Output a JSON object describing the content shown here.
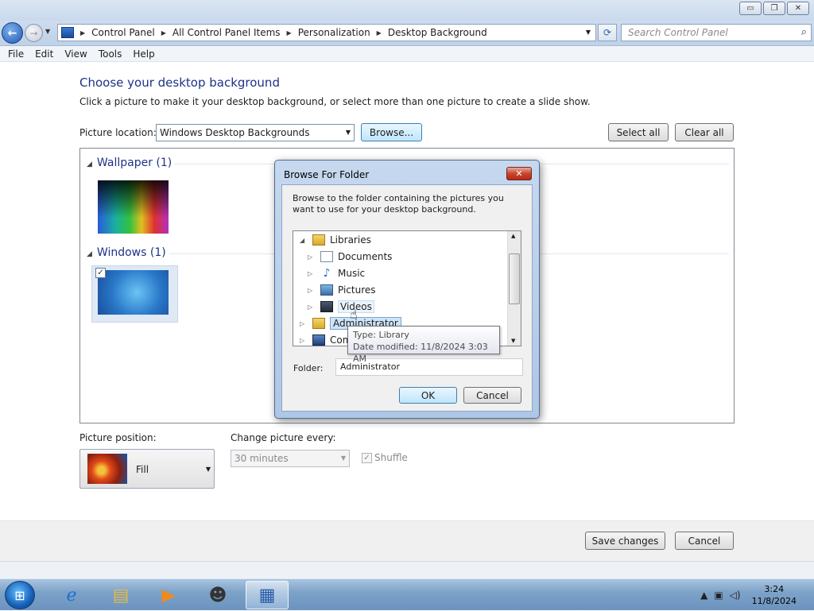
{
  "window": {
    "buttons": {
      "minimize": "▭",
      "maximize": "❐",
      "close": "✕"
    }
  },
  "nav": {
    "breadcrumbs": [
      "Control Panel",
      "All Control Panel Items",
      "Personalization",
      "Desktop Background"
    ],
    "search_placeholder": "Search Control Panel"
  },
  "menu": [
    "File",
    "Edit",
    "View",
    "Tools",
    "Help"
  ],
  "page": {
    "title": "Choose your desktop background",
    "description": "Click a picture to make it your desktop background, or select more than one picture to create a slide show.",
    "location_label": "Picture location:",
    "location_value": "Windows Desktop Backgrounds",
    "browse_label": "Browse...",
    "select_all_label": "Select all",
    "clear_all_label": "Clear all",
    "groups": [
      {
        "name": "Wallpaper (1)"
      },
      {
        "name": "Windows (1)"
      }
    ],
    "position_label": "Picture position:",
    "position_value": "Fill",
    "change_label": "Change picture every:",
    "change_value": "30 minutes",
    "shuffle_label": "Shuffle",
    "save_label": "Save changes",
    "cancel_label": "Cancel"
  },
  "dialog": {
    "title": "Browse For Folder",
    "description": "Browse to the folder containing the pictures you want to use for your desktop background.",
    "tree": [
      {
        "label": "Libraries",
        "level": 0,
        "expanded": true,
        "icon": "library-icon"
      },
      {
        "label": "Documents",
        "level": 1,
        "expanded": false,
        "icon": "documents-icon"
      },
      {
        "label": "Music",
        "level": 1,
        "expanded": false,
        "icon": "music-icon"
      },
      {
        "label": "Pictures",
        "level": 1,
        "expanded": false,
        "icon": "pictures-icon"
      },
      {
        "label": "Videos",
        "level": 1,
        "expanded": false,
        "icon": "videos-icon"
      },
      {
        "label": "Administrator",
        "level": 0,
        "expanded": false,
        "icon": "user-folder-icon"
      },
      {
        "label": "Computer",
        "level": 0,
        "expanded": false,
        "icon": "computer-icon"
      }
    ],
    "folder_label": "Folder:",
    "folder_value": "Administrator",
    "ok_label": "OK",
    "cancel_label": "Cancel",
    "tooltip_type": "Type: Library",
    "tooltip_date": "Date modified: 11/8/2024 3:03 AM"
  },
  "taskbar": {
    "time": "3:24",
    "date": "11/8/2024",
    "items": [
      "internet-explorer-icon",
      "file-explorer-icon",
      "media-player-icon",
      "raccoon-app-icon",
      "control-panel-icon"
    ]
  }
}
